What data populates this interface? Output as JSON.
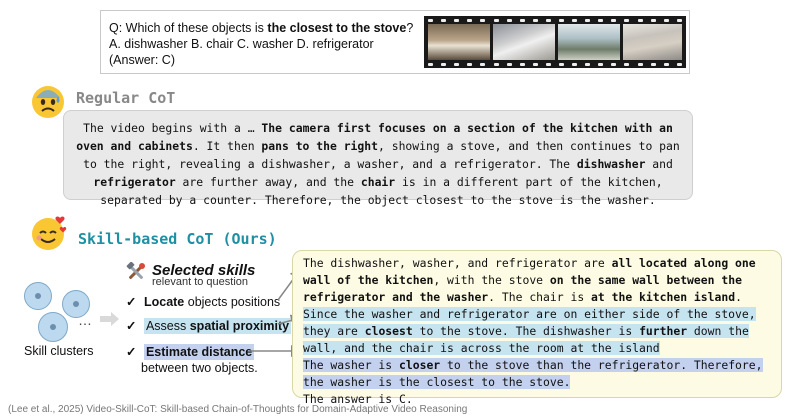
{
  "question": {
    "line1_prefix": "Q: Which of these objects is ",
    "line1_bold": "the closest to the stove",
    "line1_suffix": "?",
    "line2": "A. dishwasher B. chair C. washer D. refrigerator",
    "line3": "(Answer: C)"
  },
  "regular": {
    "title": "Regular CoT",
    "paragraph": [
      {
        "t": "The video begins with a … ",
        "b": false
      },
      {
        "t": "The camera first focuses on a section of the kitchen with an oven and cabinets",
        "b": true
      },
      {
        "t": ". It then ",
        "b": false
      },
      {
        "t": "pans to the right",
        "b": true
      },
      {
        "t": ", showing a stove, and then continues to pan to the right, revealing a dishwasher, a washer, and a refrigerator. The ",
        "b": false
      },
      {
        "t": "dishwasher",
        "b": true
      },
      {
        "t": " and ",
        "b": false
      },
      {
        "t": "refrigerator",
        "b": true
      },
      {
        "t": " are further away, and the ",
        "b": false
      },
      {
        "t": "chair",
        "b": true
      },
      {
        "t": " is in a different part of the kitchen, separated by a counter. Therefore, the object closest to the stove is the washer.",
        "b": false
      }
    ]
  },
  "skill": {
    "title": "Skill-based CoT (Ours)",
    "clusters_label": "Skill clusters",
    "ellipsis": "…",
    "selected_title": "Selected skills",
    "selected_subtitle": "relevant to question",
    "items": {
      "i1_bold": "Locate",
      "i1_rest": " objects positions",
      "i2_pre": "Assess ",
      "i2_bold": "spatial proximity",
      "i3_bold": "Estimate distance",
      "i3_rest": "between two objects."
    },
    "answer": [
      {
        "t": "The dishwasher, washer, and refrigerator are ",
        "b": false,
        "h": ""
      },
      {
        "t": "all located along one wall of the kitchen",
        "b": true,
        "h": ""
      },
      {
        "t": ", with the stove ",
        "b": false,
        "h": ""
      },
      {
        "t": "on the same wall between the refrigerator and the washer",
        "b": true,
        "h": ""
      },
      {
        "t": ". The chair is ",
        "b": false,
        "h": ""
      },
      {
        "t": "at the kitchen island",
        "b": true,
        "h": ""
      },
      {
        "t": ".",
        "b": false,
        "h": ""
      },
      {
        "t": "Since the washer and refrigerator are on either side of the stove, they are ",
        "b": false,
        "h": "hl1"
      },
      {
        "t": "closest",
        "b": true,
        "h": "hl1"
      },
      {
        "t": " to the stove. The dishwasher is ",
        "b": false,
        "h": "hl1"
      },
      {
        "t": "further",
        "b": true,
        "h": "hl1"
      },
      {
        "t": " down the wall, and the chair is across the room at the island",
        "b": false,
        "h": "hl1"
      },
      {
        "t": "The washer is ",
        "b": false,
        "h": "hl2"
      },
      {
        "t": "closer",
        "b": true,
        "h": "hl2"
      },
      {
        "t": " to the stove than the refrigerator. Therefore, the washer is the closest to the stove.",
        "b": false,
        "h": "hl2"
      },
      {
        "t": "The answer is C.",
        "b": false,
        "h": ""
      }
    ]
  },
  "footer": "(Lee et al., 2025) Video-Skill-CoT: Skill-based Chain-of-Thoughts for Domain-Adaptive Video Reasoning",
  "colors": {
    "accent_teal": "#1f8fa3",
    "highlight_cyan": "#c6e3f0",
    "highlight_blue": "#c3d1ef",
    "skill_box_bg": "#fdfbe3"
  }
}
